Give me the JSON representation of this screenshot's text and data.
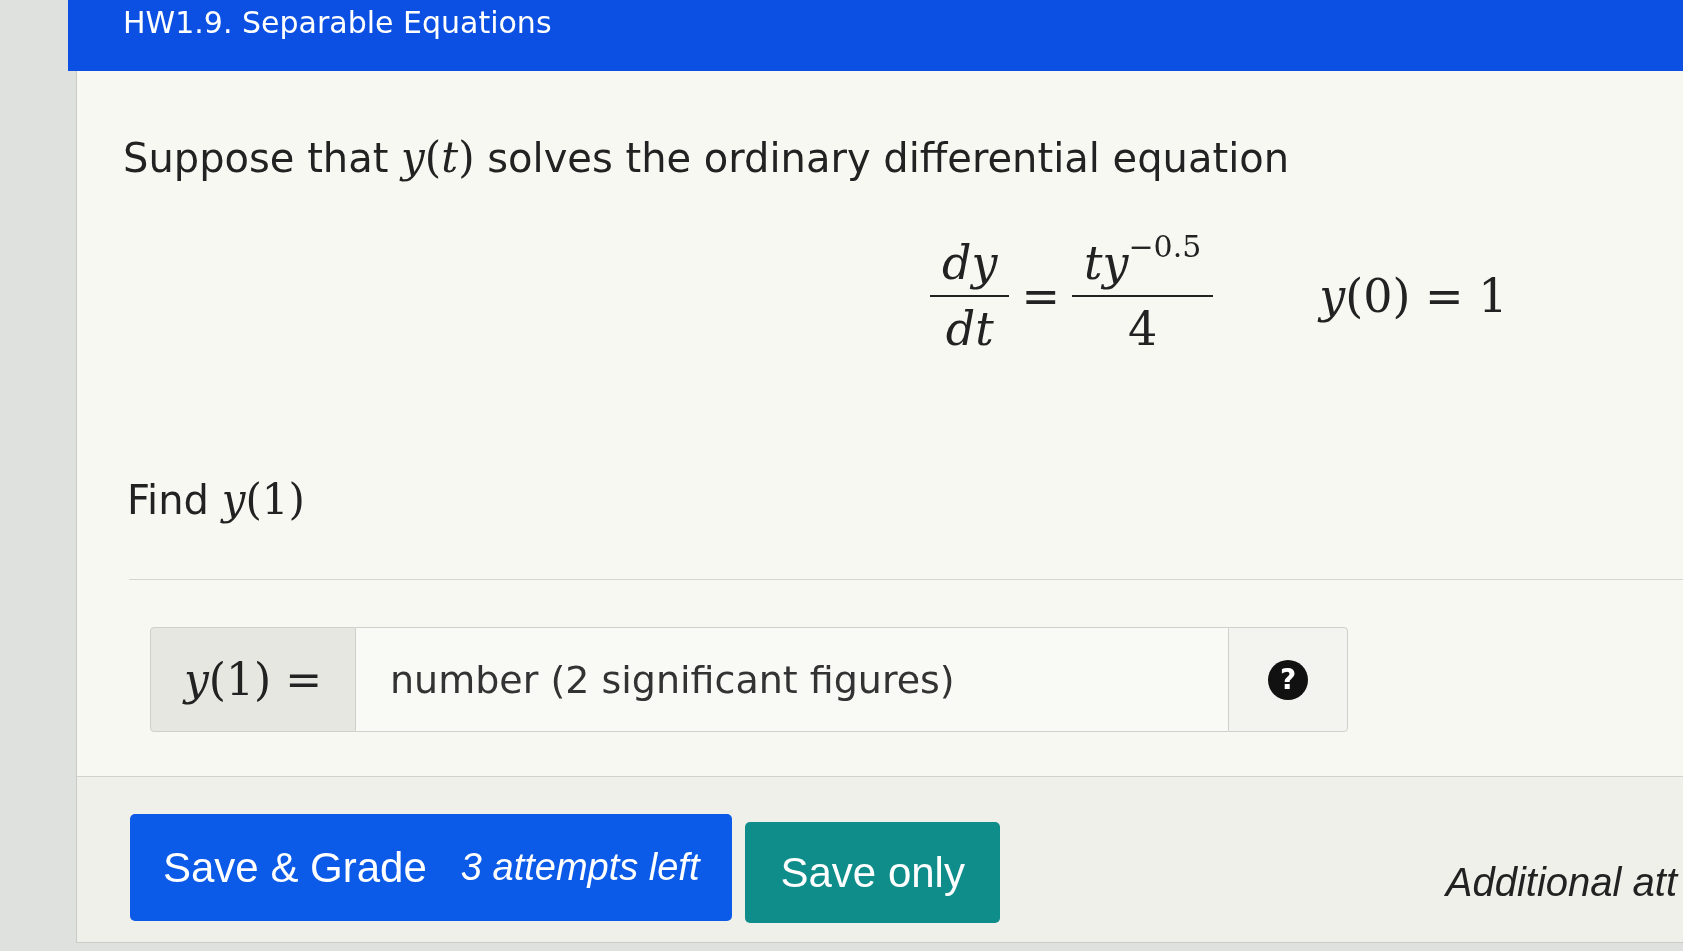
{
  "header": {
    "title": "HW1.9. Separable Equations"
  },
  "question": {
    "prompt": {
      "text": "Suppose that",
      "math": "*y*(*t*)",
      "text_after": "solves the ordinary differential equation"
    },
    "equation": {
      "lhs_numerator": "dy",
      "lhs_denominator": "dt",
      "relation": "=",
      "rhs_numerator": "*ty*$^{−0.5}$",
      "rhs_denominator": "4",
      "condition": "*y*(0) = 1"
    },
    "task": {
      "text": "Find",
      "math": "*y*(1)"
    },
    "answer": {
      "label": "*y*(1) =",
      "placeholder": "number (2 significant figures)",
      "help": "?"
    }
  },
  "footer": {
    "grade_button": {
      "label": "Save & Grade",
      "attempts": "3 attempts left"
    },
    "save_button": {
      "label": "Save only"
    },
    "note": "Additional att"
  }
}
